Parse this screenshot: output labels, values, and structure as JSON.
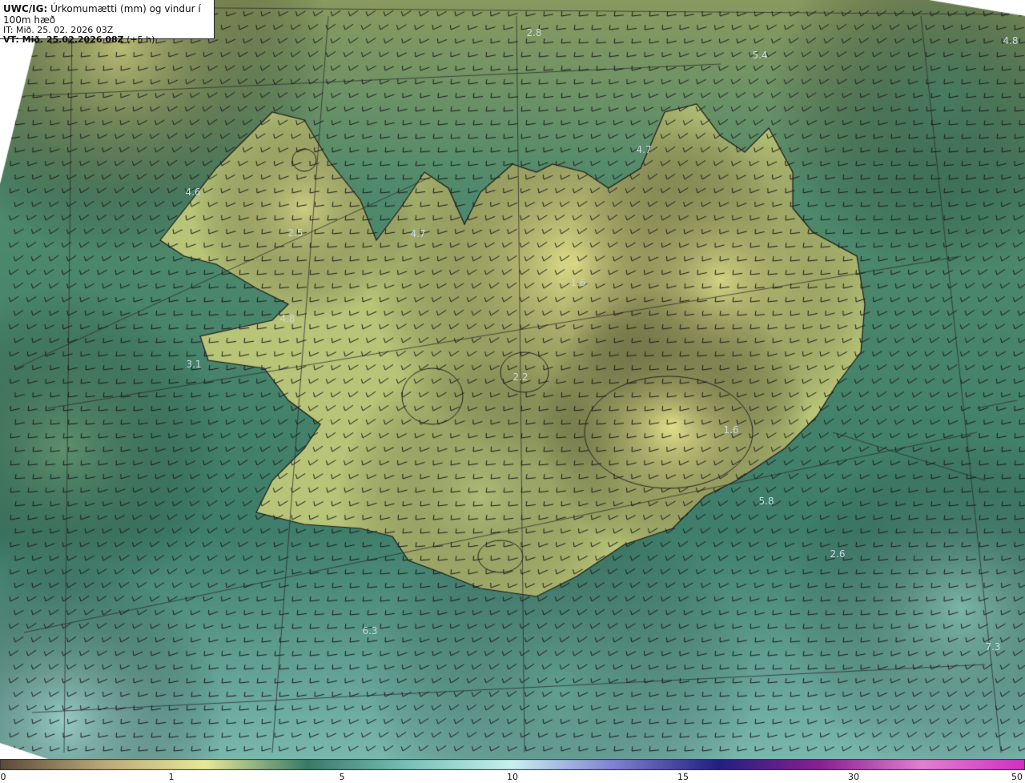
{
  "header": {
    "product": "UWC/IG:",
    "title": "Úrkomumætti (mm) og vindur í 100m hæð",
    "init_label": "IT:",
    "init_time": "Mið. 25. 02. 2026 03Z",
    "valid_label": "VT: Mið. 25.02.2026 08Z",
    "valid_offset": "(+5 h)"
  },
  "map_labels": [
    {
      "text": "2.8"
    },
    {
      "text": "4.8"
    },
    {
      "text": "5.4"
    },
    {
      "text": "4.7"
    },
    {
      "text": "4.6"
    },
    {
      "text": "4.7"
    },
    {
      "text": "2.5"
    },
    {
      "text": "1.6"
    },
    {
      "text": "4.8"
    },
    {
      "text": "3.1"
    },
    {
      "text": "2.2"
    },
    {
      "text": "5.8"
    },
    {
      "text": "2.6"
    },
    {
      "text": "6.3"
    },
    {
      "text": "7.3"
    },
    {
      "text": "1.6"
    }
  ],
  "colorbar": {
    "ticks": [
      "0",
      "1",
      "5",
      "10",
      "15",
      "30",
      "50"
    ],
    "colors": [
      "#5a4a3a",
      "#b8a878",
      "#e8e898",
      "#3a7a68",
      "#7ac0b8",
      "#c8f0f0",
      "#8080d0",
      "#202080",
      "#8a2090",
      "#e080d0",
      "#d030c0"
    ]
  },
  "map_colors": {
    "land_high": "#ece890",
    "land_mid": "#b8c478",
    "sea": "#3e7e68",
    "sea_light": "#6aa89a",
    "coast": "#1a1a1a"
  }
}
